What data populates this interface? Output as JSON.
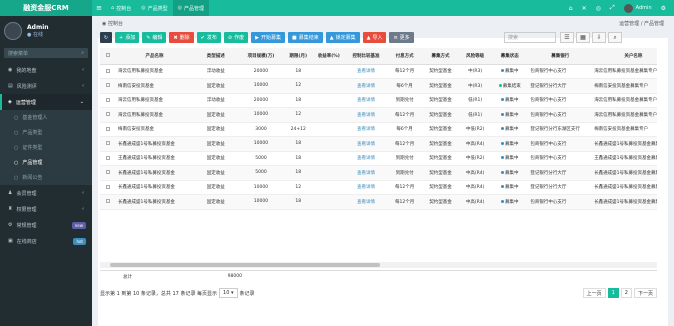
{
  "app": {
    "logo": "融资金服CRM",
    "toggle": "≡"
  },
  "top_tabs": [
    {
      "label": "控制台",
      "icon": "home-icon"
    },
    {
      "label": "产品类型",
      "icon": "circle-icon"
    },
    {
      "label": "产品管理",
      "icon": "circle-icon"
    }
  ],
  "top_right": {
    "user": "Admin",
    "icons": [
      "home-icon",
      "trash-icon",
      "globe-icon",
      "expand-icon",
      "gear-icon"
    ]
  },
  "user": {
    "name": "Admin",
    "status": "● 在线"
  },
  "sidebar_search": {
    "placeholder": "搜索菜单"
  },
  "menu": [
    {
      "label": "我的地盘",
      "icon": "dashboard-icon"
    },
    {
      "label": "风险测评",
      "icon": "chart-icon"
    },
    {
      "label": "运营管理",
      "icon": "cube-icon",
      "open": true,
      "children": [
        {
          "label": "基金管理人"
        },
        {
          "label": "产品类型"
        },
        {
          "label": "证件类型"
        },
        {
          "label": "产品管理",
          "active": true
        },
        {
          "label": "新闻公告"
        }
      ]
    },
    {
      "label": "会员管理",
      "icon": "user-icon"
    },
    {
      "label": "权限管理",
      "icon": "group-icon"
    },
    {
      "label": "常规管理",
      "icon": "gear-icon",
      "badge": "new",
      "badge_color": "#605ca8"
    },
    {
      "label": "在线商店",
      "icon": "shop-icon",
      "badge": "hot",
      "badge_color": "#3c8dbc"
    }
  ],
  "breadcrumb": {
    "left": "控制台",
    "right": "运营管理 / 产品管理"
  },
  "toolbar": [
    {
      "label": "",
      "color": "#2c3e50",
      "icon": "refresh-icon"
    },
    {
      "label": "添加",
      "color": "#18bc9c",
      "icon": "plus-icon"
    },
    {
      "label": "编辑",
      "color": "#18bc9c",
      "icon": "pencil-icon"
    },
    {
      "label": "删除",
      "color": "#e74c3c",
      "icon": "trash-icon"
    },
    {
      "label": "发布",
      "color": "#18bc9c",
      "icon": "check-icon"
    },
    {
      "label": "作废",
      "color": "#18bc9c",
      "icon": "ban-icon"
    },
    {
      "label": "开始募集",
      "color": "#3498db",
      "icon": "play-icon"
    },
    {
      "label": "募集结束",
      "color": "#3498db",
      "icon": "stop-icon"
    },
    {
      "label": "锁定募集",
      "color": "#3498db",
      "icon": "lock-icon"
    },
    {
      "label": "导入",
      "color": "#e74c3c",
      "icon": "upload-icon"
    },
    {
      "label": "更多",
      "color": "#6c7a89",
      "icon": "dots-icon"
    }
  ],
  "table_search": {
    "placeholder": "搜索"
  },
  "table": {
    "columns": [
      "",
      "产品名称",
      "类型描述",
      "项目规模(万)",
      "期限(月)",
      "收益率(%)",
      "控制比较基准",
      "付息方式",
      "募集方式",
      "风险等级",
      "募集状态",
      "募集银行",
      "关户名称",
      "募集账号"
    ],
    "rows": [
      [
        "",
        "海云信用私募投资基金",
        "浮动收益",
        "20000",
        "18",
        "",
        "查看详情",
        "每12个月",
        "契约型基金",
        "中(R3)",
        "募集中",
        "包商银行中心支行",
        "海云信用私募投资基金募集专户",
        "65654512"
      ],
      [
        "",
        "梅南信安投资基金",
        "固定收益",
        "10000",
        "12",
        "",
        "查看详情",
        "每6个月",
        "契约型基金",
        "中(R3)",
        "募集结束",
        "登记银行分行大厅",
        "梅南信安投资基金募集专户",
        "56666565"
      ],
      [
        "",
        "海云信用私募投资基金",
        "浮动收益",
        "20000",
        "18",
        "",
        "查看详情",
        "到期兑付",
        "契约型基金",
        "低(R1)",
        "募集中",
        "包商银行中心支行",
        "海云信用私募投资基金募集专户",
        "65654512"
      ],
      [
        "",
        "海云信用私募投资基金",
        "固定收益",
        "10000",
        "12",
        "",
        "查看详情",
        "每12个月",
        "契约型基金",
        "低(R1)",
        "募集中",
        "包商银行中心支行",
        "海云信用私募投资基金募集专户",
        "62155660"
      ],
      [
        "",
        "梅南信安投资基金",
        "固定收益",
        "3000",
        "24+12",
        "",
        "查看详情",
        "每6个月",
        "契约型基金",
        "中低(R2)",
        "募集中",
        "登记银行分行东湖区支行",
        "梅南信安投资基金募集专户",
        "65665235"
      ],
      [
        "",
        "长鑫通成盛1号私募投资基金",
        "固定收益",
        "10000",
        "18",
        "",
        "查看详情",
        "每12个月",
        "契约型基金",
        "中高(R4)",
        "募集中",
        "包商银行中心支行",
        "长鑫通成盛1号私募投资基金募集专户",
        "65656545"
      ],
      [
        "",
        "王鑫通成盛1号私募投资基金",
        "固定收益",
        "5000",
        "18",
        "",
        "查看详情",
        "到期兑付",
        "契约型基金",
        "中低(R2)",
        "募集中",
        "包商银行中心支行",
        "王鑫通成盛1号私募投资基金募集专户",
        "65656545"
      ],
      [
        "",
        "长鑫通成盛1号私募投资基金",
        "固定收益",
        "5000",
        "18",
        "",
        "查看详情",
        "到期兑付",
        "契约型基金",
        "中高(R4)",
        "募集中",
        "登记银行分行大厅",
        "长鑫通成盛1号私募投资基金募集专户",
        "65656545"
      ],
      [
        "",
        "长鑫通成盛1号私募投资基金",
        "固定收益",
        "10000",
        "12",
        "",
        "查看详情",
        "每12个月",
        "契约型基金",
        "中高(R4)",
        "募集中",
        "登记银行分行大厅",
        "长鑫通成盛1号私募投资基金募集专户",
        "65656545"
      ],
      [
        "",
        "长鑫通成盛1号私募投资基金",
        "固定收益",
        "10000",
        "18",
        "",
        "查看详情",
        "每12个月",
        "契约型基金",
        "中高(R4)",
        "募集中",
        "包商银行中心支行",
        "长鑫通成盛1号私募投资基金募集专户",
        "65656545"
      ]
    ],
    "status_colors": {
      "募集中": "#3c8dbc",
      "募集结束": "#18bc9c"
    }
  },
  "summary": {
    "label": "总计",
    "value": "98000"
  },
  "footer": {
    "info_prefix": "显示第 1 到第 10 条记录，总共 17 条记录 每页显示",
    "page_size": "10 ▾",
    "info_suffix": "条记录"
  },
  "pager": {
    "prev": "上一页",
    "pages": [
      "1",
      "2"
    ],
    "current": "1",
    "next": "下一页"
  }
}
